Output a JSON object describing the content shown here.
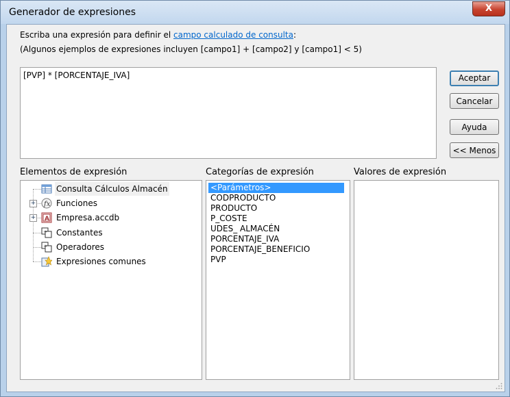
{
  "window": {
    "title": "Generador de expresiones",
    "close_label": "X"
  },
  "instructions": {
    "line1_prefix": "Escriba una expresión para definir el ",
    "line1_link": "campo calculado de consulta",
    "line1_suffix": ":",
    "line2": "(Algunos ejemplos de expresiones incluyen [campo1] + [campo2] y [campo1] < 5)"
  },
  "expression": {
    "value": "[PVP] * [PORCENTAJE_IVA]"
  },
  "buttons": {
    "accept": "Aceptar",
    "cancel": "Cancelar",
    "help": "Ayuda",
    "less": "<< Menos"
  },
  "panes": {
    "elements_label": "Elementos de expresión",
    "categories_label": "Categorías de expresión",
    "values_label": "Valores de expresión"
  },
  "tree": [
    {
      "label": "Consulta Cálculos Almacén",
      "icon": "query-icon",
      "expandable": false,
      "selected": true
    },
    {
      "label": "Funciones",
      "icon": "function-icon",
      "expandable": true
    },
    {
      "label": "Empresa.accdb",
      "icon": "database-icon",
      "expandable": true
    },
    {
      "label": "Constantes",
      "icon": "constants-icon",
      "expandable": false
    },
    {
      "label": "Operadores",
      "icon": "operators-icon",
      "expandable": false
    },
    {
      "label": "Expresiones comunes",
      "icon": "common-expressions-icon",
      "expandable": false
    }
  ],
  "categories": [
    "<Parámetros>",
    "CODPRODUCTO",
    "PRODUCTO",
    "P_COSTE",
    "UDES_ ALMACÉN",
    "PORCENTAJE_IVA",
    "PORCENTAJE_BENEFICIO",
    "PVP"
  ],
  "colors": {
    "selection": "#3399ff",
    "link": "#0066cc"
  }
}
